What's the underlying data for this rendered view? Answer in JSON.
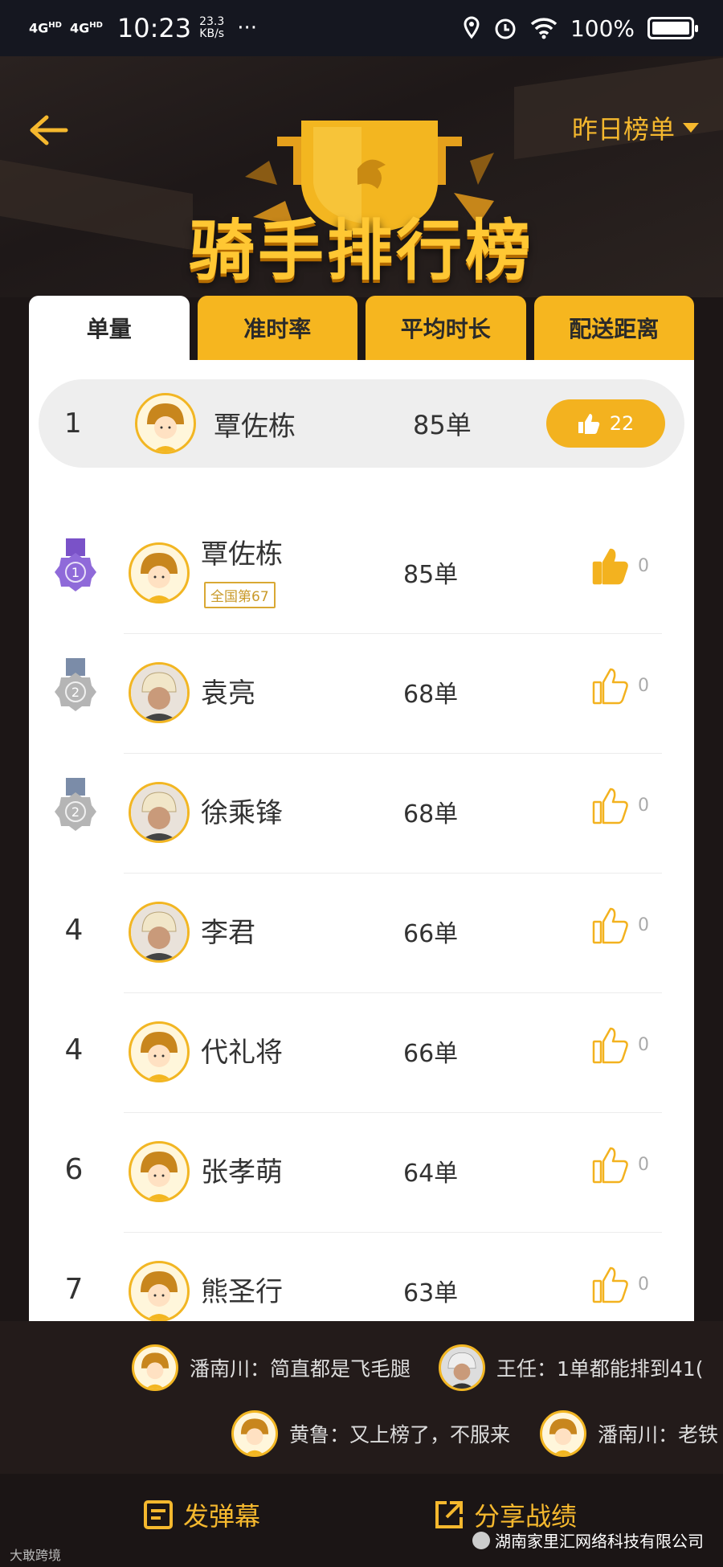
{
  "status_bar": {
    "net1": "4G",
    "net1_sup": "HD",
    "net2": "4G",
    "net2_sup": "HD",
    "time": "10:23",
    "speed_value": "23.3",
    "speed_unit": "KB/s",
    "dots": "···",
    "battery": "100%"
  },
  "header": {
    "title": "骑手排行榜",
    "period_label": "昨日榜单"
  },
  "tabs": [
    {
      "label": "单量",
      "active": true
    },
    {
      "label": "准时率",
      "active": false
    },
    {
      "label": "平均时长",
      "active": false
    },
    {
      "label": "配送距离",
      "active": false
    }
  ],
  "my_rank": {
    "rank": "1",
    "name": "覃佐栋",
    "orders": "85单",
    "likes": "22"
  },
  "riders": [
    {
      "rank": "1",
      "medal": "gold",
      "medal_text": "1",
      "name": "覃佐栋",
      "badge": "全国第67",
      "orders": "85单",
      "likes": "0",
      "liked": true
    },
    {
      "rank": "2",
      "medal": "silver",
      "medal_text": "2",
      "name": "袁亮",
      "badge": "",
      "orders": "68单",
      "likes": "0",
      "liked": false
    },
    {
      "rank": "2",
      "medal": "silver",
      "medal_text": "2",
      "name": "徐乘锋",
      "badge": "",
      "orders": "68单",
      "likes": "0",
      "liked": false
    },
    {
      "rank": "4",
      "medal": "",
      "medal_text": "",
      "name": "李君",
      "badge": "",
      "orders": "66单",
      "likes": "0",
      "liked": false
    },
    {
      "rank": "4",
      "medal": "",
      "medal_text": "",
      "name": "代礼将",
      "badge": "",
      "orders": "66单",
      "likes": "0",
      "liked": false
    },
    {
      "rank": "6",
      "medal": "",
      "medal_text": "",
      "name": "张孝萌",
      "badge": "",
      "orders": "64单",
      "likes": "0",
      "liked": false
    },
    {
      "rank": "7",
      "medal": "",
      "medal_text": "",
      "name": "熊圣行",
      "badge": "",
      "orders": "63单",
      "likes": "0",
      "liked": false
    }
  ],
  "danmu": [
    {
      "text": "潘南川：简直都是飞毛腿"
    },
    {
      "text": "王任：1单都能排到41("
    },
    {
      "text": "黄鲁：又上榜了，不服来"
    },
    {
      "text": "潘南川：老铁"
    }
  ],
  "bottom": {
    "danmu_button": "发弹幕",
    "share_button": "分享战绩",
    "watermark": "湖南家里汇网络科技有限公司",
    "brand": "大敢跨境"
  },
  "colors": {
    "accent": "#f5b82e",
    "tab_yellow": "#f6b61f",
    "background": "#1c1616"
  }
}
